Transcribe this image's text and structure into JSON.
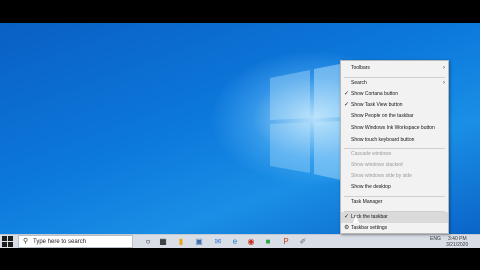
{
  "search": {
    "placeholder": "Type here to search"
  },
  "menu": {
    "items": [
      {
        "label": "Toolbars",
        "submenu": true
      },
      {
        "label": "Search",
        "submenu": true
      },
      {
        "label": "Show Cortana button",
        "checked": true
      },
      {
        "label": "Show Task View button",
        "checked": true
      },
      {
        "label": "Show People on the taskbar"
      },
      {
        "label": "Show Windows Ink Workspace button"
      },
      {
        "label": "Show touch keyboard button"
      },
      {
        "label": "Cascade windows",
        "disabled": true
      },
      {
        "label": "Show windows stacked",
        "disabled": true
      },
      {
        "label": "Show windows side by side",
        "disabled": true
      },
      {
        "label": "Show the desktop"
      },
      {
        "label": "Task Manager"
      },
      {
        "label": "Lock the taskbar",
        "checked": true
      },
      {
        "label": "Taskbar settings"
      }
    ]
  },
  "tray": {
    "time": "3:40 PM",
    "date": "3/21/2020",
    "lang": "ENG"
  },
  "colors": {
    "desktop": "#0c79dc",
    "taskbar": "#d9dee6",
    "menu": "#f2f2f2"
  }
}
